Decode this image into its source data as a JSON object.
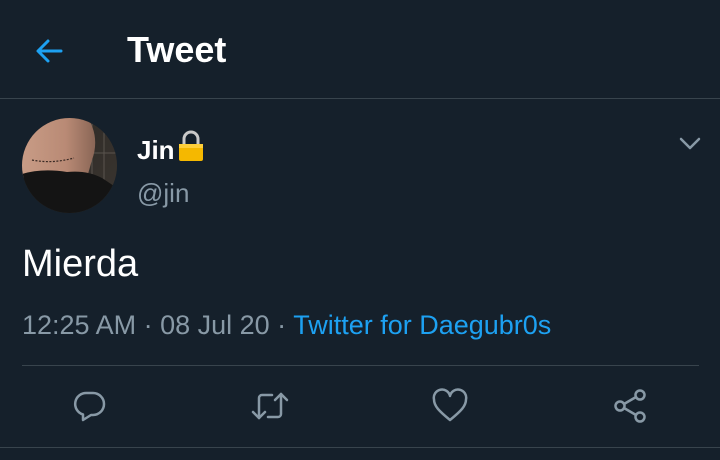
{
  "header": {
    "title": "Tweet",
    "back_icon": "arrow-left-icon"
  },
  "tweet": {
    "author": {
      "display_name": "Jin",
      "lock_icon": "lock-icon",
      "handle": "@jin"
    },
    "text": "Mierda",
    "time": "12:25 AM",
    "separator": " · ",
    "date": "08 Jul 20",
    "source": "Twitter for Daegubr0s"
  },
  "actions": [
    "reply-icon",
    "retweet-icon",
    "like-icon",
    "share-icon"
  ],
  "colors": {
    "background": "#15202b",
    "accent": "#1da1f2",
    "muted": "#8899a6",
    "divider": "#38444d",
    "lock": "#f5b800"
  }
}
